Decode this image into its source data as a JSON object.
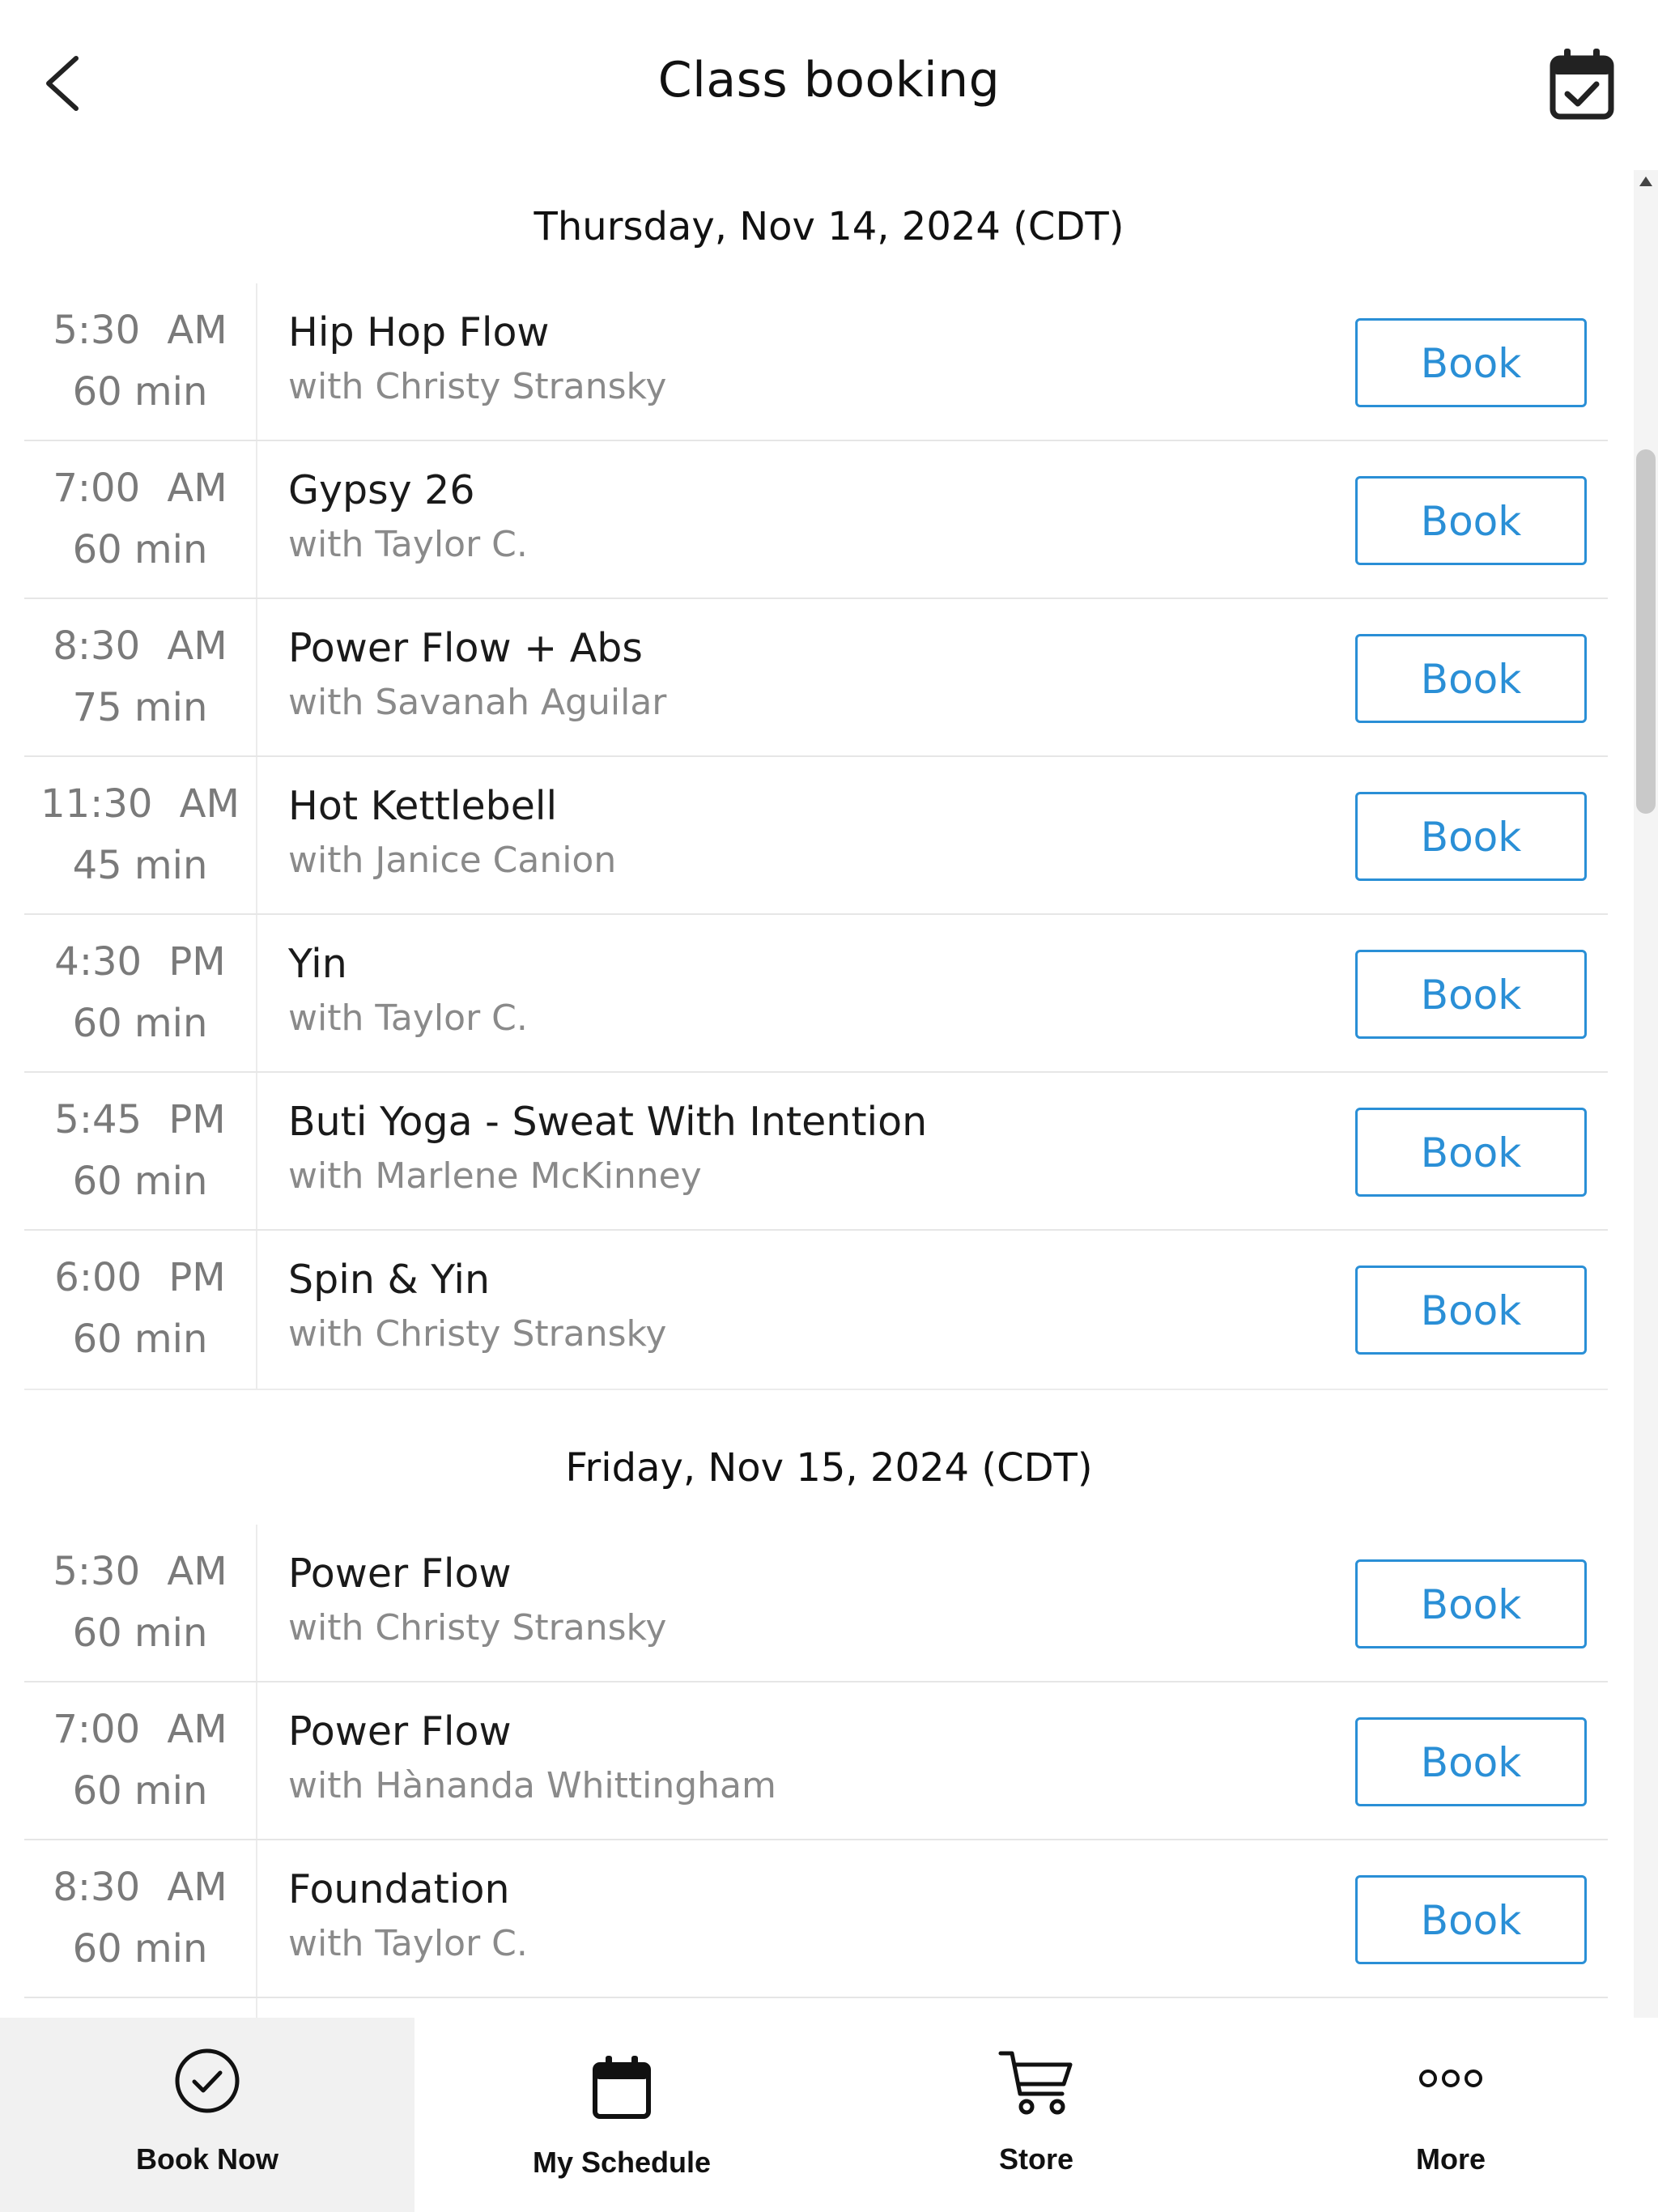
{
  "header": {
    "title": "Class booking",
    "back_icon": "chevron-left-icon",
    "calendar_icon": "calendar-check-icon"
  },
  "days": [
    {
      "heading": "Thursday, Nov 14, 2024 (CDT)",
      "classes": [
        {
          "time": "5:30 AM",
          "duration": "60 min",
          "name": "Hip Hop Flow",
          "instructor": "with Christy Stransky",
          "action": "Book"
        },
        {
          "time": "7:00 AM",
          "duration": "60 min",
          "name": "Gypsy 26",
          "instructor": "with Taylor C.",
          "action": "Book"
        },
        {
          "time": "8:30 AM",
          "duration": "75 min",
          "name": "Power Flow + Abs",
          "instructor": "with Savanah Aguilar",
          "action": "Book"
        },
        {
          "time": "11:30 AM",
          "duration": "45 min",
          "name": "Hot Kettlebell",
          "instructor": "with Janice Canion",
          "action": "Book"
        },
        {
          "time": "4:30 PM",
          "duration": "60 min",
          "name": "Yin",
          "instructor": "with Taylor C.",
          "action": "Book"
        },
        {
          "time": "5:45 PM",
          "duration": "60 min",
          "name": "Buti Yoga - Sweat With Intention",
          "instructor": "with Marlene McKinney",
          "action": "Book"
        },
        {
          "time": "6:00 PM",
          "duration": "60 min",
          "name": "Spin & Yin",
          "instructor": "with Christy Stransky",
          "action": "Book"
        }
      ]
    },
    {
      "heading": "Friday, Nov 15, 2024 (CDT)",
      "classes": [
        {
          "time": "5:30 AM",
          "duration": "60 min",
          "name": "Power Flow",
          "instructor": "with Christy Stransky",
          "action": "Book"
        },
        {
          "time": "7:00 AM",
          "duration": "60 min",
          "name": "Power Flow",
          "instructor": "with Hànanda Whittingham",
          "action": "Book"
        },
        {
          "time": "8:30 AM",
          "duration": "60 min",
          "name": "Foundation",
          "instructor": "with Taylor C.",
          "action": "Book"
        }
      ]
    }
  ],
  "nav": [
    {
      "label": "Book Now",
      "icon": "check-circle-icon",
      "active": true
    },
    {
      "label": "My Schedule",
      "icon": "calendar-icon",
      "active": false
    },
    {
      "label": "Store",
      "icon": "cart-icon",
      "active": false
    },
    {
      "label": "More",
      "icon": "more-dots-icon",
      "active": false
    }
  ],
  "colors": {
    "accent": "#2a8fd6",
    "text": "#111111",
    "muted": "#8a8a8a",
    "nav_active_bg": "#f1f1f1"
  }
}
